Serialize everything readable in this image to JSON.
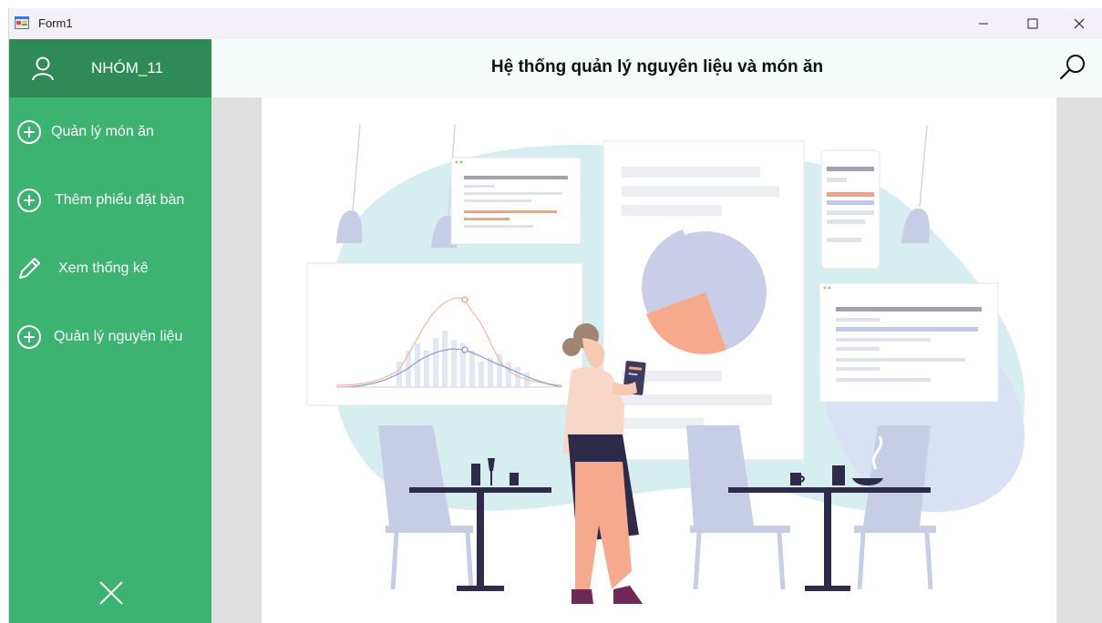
{
  "window": {
    "title": "Form1",
    "minimize_icon": "minimize-icon",
    "maximize_icon": "maximize-icon",
    "close_icon": "close-icon"
  },
  "sidebar": {
    "user_icon": "user-icon",
    "user_name": "NHÓM_11",
    "items": [
      {
        "icon": "plus-circle-icon",
        "label": "Quản lý món ăn"
      },
      {
        "icon": "plus-circle-icon",
        "label": "Thêm phiếu đặt bàn"
      },
      {
        "icon": "pencil-icon",
        "label": "Xem thống kê"
      },
      {
        "icon": "plus-circle-icon",
        "label": "Quản lý nguyên liệu"
      }
    ],
    "close_icon": "close-icon"
  },
  "header": {
    "title": "Hệ thống quản lý nguyên liệu và món ăn",
    "search_icon": "search-icon"
  },
  "colors": {
    "sidebar": "#3cb371",
    "sidebar_header": "#2e8b57",
    "header_bg": "#f4fbf8",
    "content_bg": "#e0e0e0"
  }
}
